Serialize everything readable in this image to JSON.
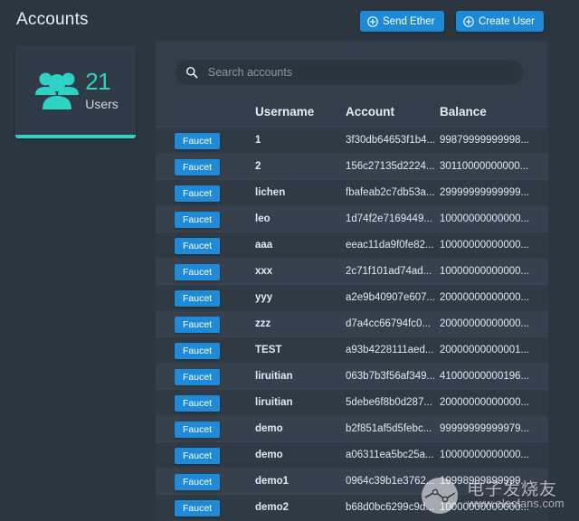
{
  "header": {
    "title": "Accounts",
    "buttons": [
      {
        "label": "Send Ether",
        "icon": "plus-circle-icon"
      },
      {
        "label": "Create User",
        "icon": "plus-circle-icon"
      }
    ],
    "accent_color": "#1e8ad6"
  },
  "stat_card": {
    "icon": "users-group-icon",
    "count": "21",
    "label": "Users",
    "accent_color": "#2ed3c6"
  },
  "search": {
    "icon": "search-icon",
    "placeholder": "Search accounts",
    "value": ""
  },
  "table": {
    "columns": [
      "",
      "Username",
      "Account",
      "Balance"
    ],
    "action_label": "Faucet",
    "rows": [
      {
        "username": "1",
        "account": "3f30db64653f1b4...",
        "balance": "99879999999998..."
      },
      {
        "username": "2",
        "account": "156c27135d2224...",
        "balance": "30110000000000..."
      },
      {
        "username": "lichen",
        "account": "fbafeab2c7db53a...",
        "balance": "29999999999999..."
      },
      {
        "username": "leo",
        "account": "1d74f2e7169449...",
        "balance": "10000000000000..."
      },
      {
        "username": "aaa",
        "account": "eeac11da9f0fe82...",
        "balance": "10000000000000..."
      },
      {
        "username": "xxx",
        "account": "2c71f101ad74ad...",
        "balance": "10000000000000..."
      },
      {
        "username": "yyy",
        "account": "a2e9b40907e607...",
        "balance": "20000000000000..."
      },
      {
        "username": "zzz",
        "account": "d7a4cc66794fc0...",
        "balance": "20000000000000..."
      },
      {
        "username": "TEST",
        "account": "a93b4228111aed...",
        "balance": "20000000000001..."
      },
      {
        "username": "liruitian",
        "account": "063b7b3f56af349...",
        "balance": "41000000000196..."
      },
      {
        "username": "liruitian",
        "account": "5debe6f8b0d287...",
        "balance": "20000000000000..."
      },
      {
        "username": "demo",
        "account": "b2f851af5d5febc...",
        "balance": "99999999999979..."
      },
      {
        "username": "demo",
        "account": "a06311ea5bc25a...",
        "balance": "10000000000000..."
      },
      {
        "username": "demo1",
        "account": "0964c39b1e3762...",
        "balance": "19998999899999..."
      },
      {
        "username": "demo2",
        "account": "b68d0bc6299c9d...",
        "balance": "10000000000000..."
      }
    ]
  },
  "watermark": {
    "text_cn": "电子发烧友",
    "url": "www.elecfans.com"
  }
}
